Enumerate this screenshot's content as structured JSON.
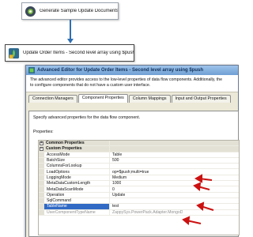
{
  "canvas": {
    "task1_label": "Generate Sample Update Documents",
    "task2_label": "Update Order Items - Second level array using $push",
    "task1_icon": "gear-database-icon",
    "task2_icon": "mongodb-destination-icon"
  },
  "dialog": {
    "title": "Advanced Editor for Update Order Items - Second level array using $push",
    "description_line1": "The advanced editor provides access to the low-level properties of data flow components. Additionally, the",
    "description_line2": "to configure components that do not have a custom user interface.",
    "tabs": [
      {
        "label": "Connection Managers"
      },
      {
        "label": "Component Properties"
      },
      {
        "label": "Column Mappings"
      },
      {
        "label": "Input and Output Properties"
      }
    ],
    "active_tab": "Component Properties",
    "panel_description": "Specify advanced properties for the data flow component.",
    "properties_label": "Properties:"
  },
  "properties": {
    "common_category": "Common Properties",
    "custom_category": "Custom Properties",
    "rows": [
      {
        "name": "AccessMode",
        "value": "Table"
      },
      {
        "name": "BatchSize",
        "value": "500"
      },
      {
        "name": "ColumnsForLookup",
        "value": ""
      },
      {
        "name": "LoadOptions",
        "value": "op=$push;multi=true"
      },
      {
        "name": "LoggingMode",
        "value": "Medium"
      },
      {
        "name": "MetaDataCustomLength",
        "value": "1000"
      },
      {
        "name": "MetaDataScanMode",
        "value": "0"
      },
      {
        "name": "Operation",
        "value": "Update"
      },
      {
        "name": "SqlCommand",
        "value": ""
      },
      {
        "name": "TableName",
        "value": "test"
      },
      {
        "name": "UserComponentTypeName",
        "value": "ZappySys.PowerPack.Adapter.MongoD"
      }
    ]
  },
  "colors": {
    "annotation_arrow": "#cc1111",
    "connector": "#2e6fb3",
    "titlebar": "#7aa7da"
  }
}
